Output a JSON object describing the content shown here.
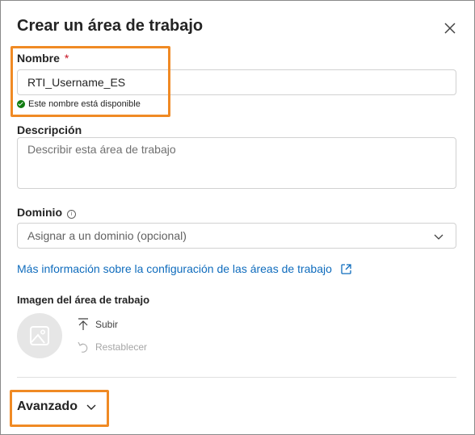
{
  "dialog": {
    "title": "Crear un área de trabajo"
  },
  "name_field": {
    "label": "Nombre",
    "required_marker": "*",
    "value": "RTI_Username_ES",
    "status": "Este nombre está disponible"
  },
  "description_field": {
    "label": "Descripción",
    "placeholder": "Describir esta área de trabajo"
  },
  "domain_field": {
    "label": "Dominio",
    "info_glyph": "i",
    "placeholder": "Asignar a un dominio (opcional)"
  },
  "learn_more_link": "Más información sobre la configuración de las áreas de trabajo",
  "image_section": {
    "label": "Imagen del área de trabajo",
    "upload_label": "Subir",
    "reset_label": "Restablecer"
  },
  "advanced": {
    "label": "Avanzado"
  },
  "colors": {
    "highlight": "#f08a24",
    "link": "#0f6cbd",
    "success": "#107c10"
  }
}
